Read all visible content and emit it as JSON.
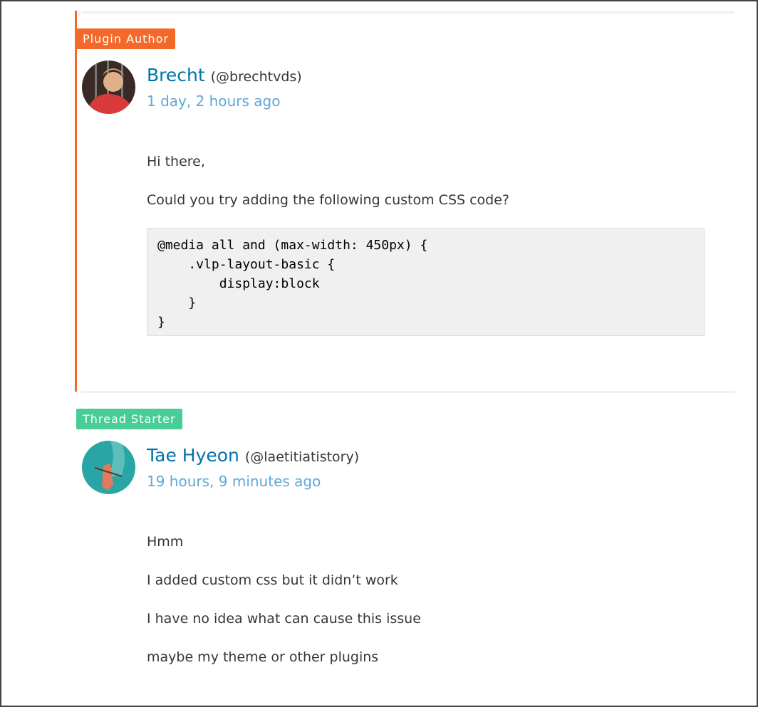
{
  "colors": {
    "author_accent": "#f4692a",
    "thread_starter": "#48cd96",
    "link": "#0073aa",
    "timestamp": "#5ea8d6"
  },
  "replies": [
    {
      "badge": "Plugin Author",
      "name": "Brecht",
      "handle": "(@brechtvds)",
      "time": "1 day, 2 hours ago",
      "paragraphs": [
        "Hi there,",
        "Could you try adding the following custom CSS code?"
      ],
      "code": "@media all and (max-width: 450px) {\n    .vlp-layout-basic {\n        display:block\n    }\n}"
    },
    {
      "badge": "Thread Starter",
      "name": "Tae Hyeon",
      "handle": "(@laetitiatistory)",
      "time": "19 hours, 9 minutes ago",
      "paragraphs": [
        "Hmm",
        "I added custom css but it didn’t work",
        "I have no idea what can cause this issue",
        "maybe my theme or other plugins"
      ]
    }
  ]
}
